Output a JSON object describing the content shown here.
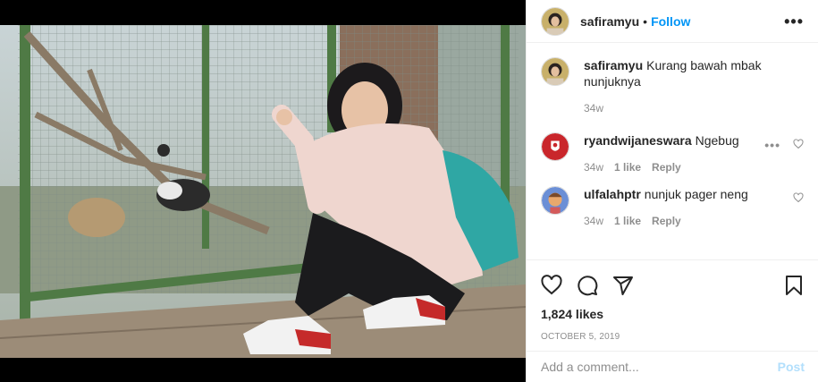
{
  "post": {
    "author": "safiramyu",
    "separator": "•",
    "follow_label": "Follow",
    "more_icon": "more-options-icon",
    "image_alt": "photo"
  },
  "comments": [
    {
      "username": "safiramyu",
      "text": "Kurang bawah mbak nunjuknya",
      "time": "34w",
      "is_caption": true
    },
    {
      "username": "ryandwijaneswara",
      "text": "Ngebug",
      "time": "34w",
      "likes": "1 like",
      "reply": "Reply"
    },
    {
      "username": "ulfalahptr",
      "text": "nunjuk pager neng",
      "time": "34w",
      "likes": "1 like",
      "reply": "Reply"
    }
  ],
  "engagement": {
    "likes": "1,824 likes",
    "date": "OCTOBER 5, 2019"
  },
  "add_comment": {
    "placeholder": "Add a comment...",
    "post_label": "Post"
  },
  "colors": {
    "link_blue": "#0095f6",
    "post_disabled": "#b2dffc",
    "muted": "#8e8e8e"
  }
}
